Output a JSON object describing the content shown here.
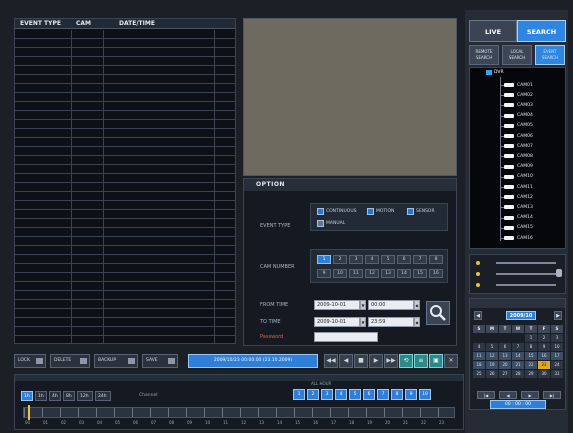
{
  "event_table": {
    "columns": [
      "EVENT TYPE",
      "CAM",
      "DATE/TIME"
    ]
  },
  "option": {
    "title": "OPTION",
    "event_type_label": "EVENT TYPE",
    "event_types": [
      "CONTINUOUS",
      "MOTION",
      "SENSOR",
      "MANUAL"
    ],
    "cam_label": "CAM NUMBER",
    "cam_row1": [
      "1",
      "2",
      "3",
      "4",
      "5",
      "6",
      "7",
      "8"
    ],
    "cam_row2": [
      "9",
      "10",
      "11",
      "12",
      "13",
      "14",
      "15",
      "16"
    ],
    "from_label": "FROM TIME",
    "to_label": "TO TIME",
    "from_date": "2009-10-01",
    "from_time": "00:00",
    "to_date": "2009-10-01",
    "to_time": "23:59",
    "password_label": "Password"
  },
  "right_panel": {
    "live_label": "LIVE",
    "search_label": "SEARCH",
    "subtabs": [
      "REMOTE SEARCH",
      "LOCAL SEARCH",
      "EVENT SEARCH"
    ],
    "tree_root": "DVR",
    "cameras": [
      "CAM01",
      "CAM02",
      "CAM03",
      "CAM04",
      "CAM05",
      "CAM06",
      "CAM07",
      "CAM08",
      "CAM09",
      "CAM10",
      "CAM11",
      "CAM12",
      "CAM13",
      "CAM14",
      "CAM15",
      "CAM16"
    ]
  },
  "calendar": {
    "month_label": "2009/10",
    "weekdays": [
      "S",
      "M",
      "T",
      "W",
      "T",
      "F",
      "S"
    ],
    "days": [
      "",
      "",
      "",
      "",
      "1",
      "2",
      "3",
      "4",
      "5",
      "6",
      "7",
      "8",
      "9",
      "10",
      "11",
      "12",
      "13",
      "14",
      "15",
      "16",
      "17",
      "18",
      "19",
      "20",
      "21",
      "22",
      "23",
      "24",
      "25",
      "26",
      "27",
      "28",
      "29",
      "30",
      "31"
    ],
    "selected_day": "23",
    "nav": [
      "◀",
      "▶"
    ],
    "foot_buttons": [
      "|◀",
      "◀",
      "▶",
      "▶|"
    ],
    "foot_time": "00 : 00 : 00"
  },
  "toolbar": {
    "lock_label": "LOCK",
    "delete_label": "DELETE",
    "backup_label": "BACKUP",
    "save_label": "SAVE",
    "datetime": "2009/10/23 00:00:00 (23.10.2009)",
    "buttons": [
      "◀◀",
      "◀",
      "■",
      "▶",
      "▶▶",
      "⟲",
      "≡",
      "▣",
      "✕"
    ]
  },
  "timeline": {
    "scales": [
      "1h",
      "1h",
      "4h",
      "8h",
      "12h",
      "24h"
    ],
    "channel_label": "Channel",
    "ch_caption": "ALL  HOUR",
    "ch_buttons": [
      "1",
      "2",
      "3",
      "4",
      "5",
      "6",
      "7",
      "8",
      "9",
      "10"
    ],
    "hours": [
      "00",
      "01",
      "02",
      "03",
      "04",
      "05",
      "06",
      "07",
      "08",
      "09",
      "10",
      "11",
      "12",
      "13",
      "14",
      "15",
      "16",
      "17",
      "18",
      "19",
      "20",
      "21",
      "22",
      "23"
    ]
  }
}
